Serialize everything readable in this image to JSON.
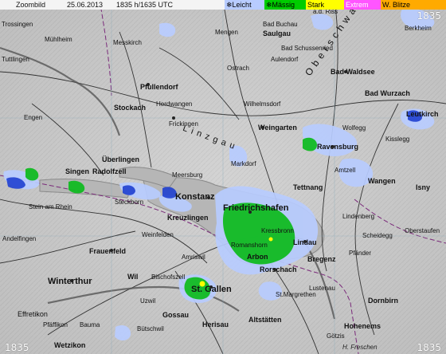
{
  "header": {
    "zoom_label": "Zoombild",
    "date": "25.06.2013",
    "time": "1835 h/1635 UTC"
  },
  "legend": [
    {
      "label": "Leicht",
      "color": "#b8ccff",
      "icon": "snowflake-icon"
    },
    {
      "label": "Mässig",
      "color": "#00cc00",
      "icon": "snowflake-icon"
    },
    {
      "label": "Stark",
      "color": "#ffff00"
    },
    {
      "label": "Extrem",
      "color": "#ff55ff"
    },
    {
      "label": "W. Blitze",
      "color": "#ffaa00"
    }
  ],
  "corners": {
    "top_right": "1835",
    "bottom_left": "1835",
    "bottom_right": "1835"
  },
  "credit": "H. Freschen",
  "places": [
    {
      "name": "Trossingen"
    },
    {
      "name": "Mühlheim"
    },
    {
      "name": "Tuttlingen"
    },
    {
      "name": "Messkirch"
    },
    {
      "name": "Mengen"
    },
    {
      "name": "Bad Buchau"
    },
    {
      "name": "Saulgau"
    },
    {
      "name": "a.d. Riss"
    },
    {
      "name": "Berkheim"
    },
    {
      "name": "Bad Schussenried"
    },
    {
      "name": "Aulendorf"
    },
    {
      "name": "Bad Waldsee"
    },
    {
      "name": "Bad Wurzach"
    },
    {
      "name": "Leutkirch"
    },
    {
      "name": "Pfullendorf"
    },
    {
      "name": "Ostrach"
    },
    {
      "name": "Stockach"
    },
    {
      "name": "Herdwangen"
    },
    {
      "name": "Wilhelmsdorf"
    },
    {
      "name": "Engen"
    },
    {
      "name": "Frickingen"
    },
    {
      "name": "Weingarten"
    },
    {
      "name": "Wolfegg"
    },
    {
      "name": "Kisslegg"
    },
    {
      "name": "Ravensburg"
    },
    {
      "name": "Überlingen"
    },
    {
      "name": "Markdorf"
    },
    {
      "name": "Singen"
    },
    {
      "name": "Radolfzell"
    },
    {
      "name": "Meersburg"
    },
    {
      "name": "Tettnang"
    },
    {
      "name": "Amtzell"
    },
    {
      "name": "Wangen"
    },
    {
      "name": "Isny"
    },
    {
      "name": "Stein am Rhein"
    },
    {
      "name": "Konstanz"
    },
    {
      "name": "Steckborn"
    },
    {
      "name": "Kreuzlingen"
    },
    {
      "name": "Friedrichshafen"
    },
    {
      "name": "Lindenberg"
    },
    {
      "name": "Andelfingen"
    },
    {
      "name": "Weinfelden"
    },
    {
      "name": "Romanshorn"
    },
    {
      "name": "Kressbronn"
    },
    {
      "name": "Lindau"
    },
    {
      "name": "Scheidegg"
    },
    {
      "name": "Oberstaufen"
    },
    {
      "name": "Frauenfeld"
    },
    {
      "name": "Amriswil"
    },
    {
      "name": "Arbon"
    },
    {
      "name": "Bregenz"
    },
    {
      "name": "Pfänder"
    },
    {
      "name": "Winterthur"
    },
    {
      "name": "Wil"
    },
    {
      "name": "Bischofszell"
    },
    {
      "name": "Rorschach"
    },
    {
      "name": "St. Gallen"
    },
    {
      "name": "Lustenau"
    },
    {
      "name": "Dornbirn"
    },
    {
      "name": "Effretikon"
    },
    {
      "name": "Uzwil"
    },
    {
      "name": "St.Margrethen"
    },
    {
      "name": "Pfäffikon"
    },
    {
      "name": "Bauma"
    },
    {
      "name": "Gossau"
    },
    {
      "name": "Herisau"
    },
    {
      "name": "Altstätten"
    },
    {
      "name": "Hohenems"
    },
    {
      "name": "Wetzikon"
    },
    {
      "name": "Bütschwil"
    },
    {
      "name": "Götzis"
    },
    {
      "name": "Linzgau"
    },
    {
      "name": "Oberschwaben"
    }
  ]
}
